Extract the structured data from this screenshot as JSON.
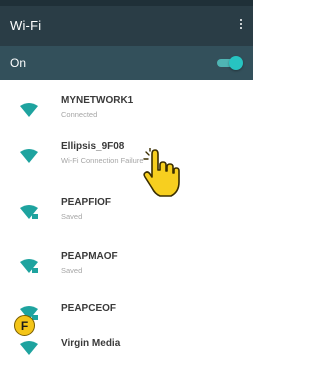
{
  "toolbar": {
    "title": "Wi-Fi",
    "menu_icon": "more-vert-icon"
  },
  "wifi_toggle": {
    "label": "On",
    "state": "on"
  },
  "networks": [
    {
      "ssid": "MYNETWORK1",
      "status": "Connected"
    },
    {
      "ssid": "Ellipsis_9F08",
      "status": "Wi-Fi Connection Failure"
    },
    {
      "ssid": "PEAPFIOF",
      "status": "Saved"
    },
    {
      "ssid": "PEAPMAOF",
      "status": "Saved"
    },
    {
      "ssid": "PEAPCEOF",
      "status": ""
    },
    {
      "ssid": "Virgin Media",
      "status": ""
    }
  ],
  "annotation": {
    "badge_letter": "F"
  },
  "colors": {
    "statusbar": "#1f3038",
    "toolbar": "#2a3d46",
    "toggle_bar": "#33505b",
    "accent": "#27c4c1",
    "wifi_icon": "#1ea39f",
    "badge": "#f4c518",
    "hand": "#f7cf1f"
  }
}
